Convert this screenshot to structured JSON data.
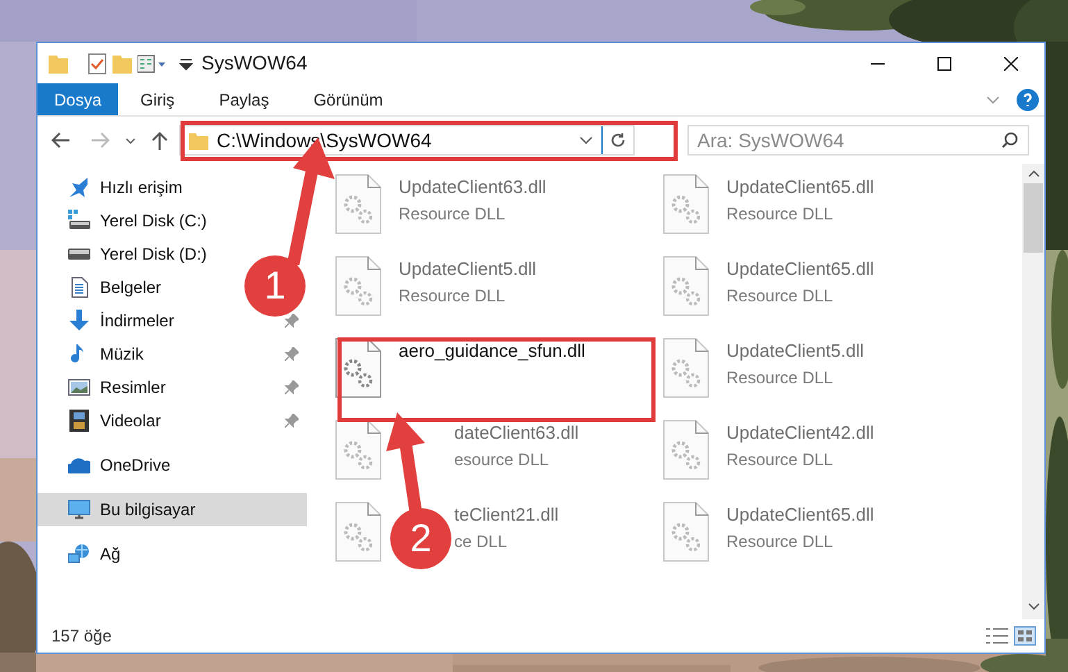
{
  "window": {
    "title": "SysWOW64"
  },
  "ribbon_tabs": [
    {
      "label": "Dosya",
      "selected": true
    },
    {
      "label": "Giriş",
      "selected": false
    },
    {
      "label": "Paylaş",
      "selected": false
    },
    {
      "label": "Görünüm",
      "selected": false
    }
  ],
  "address": {
    "path": "C:\\Windows\\SysWOW64"
  },
  "search": {
    "placeholder": "Ara: SysWOW64"
  },
  "sidebar": {
    "items": [
      {
        "label": "Hızlı erişim",
        "kind": "star",
        "pinned": false,
        "selected": false,
        "group_start": false
      },
      {
        "label": "Yerel Disk (C:)",
        "kind": "sysdrive",
        "pinned": false,
        "selected": false,
        "group_start": false
      },
      {
        "label": "Yerel Disk (D:)",
        "kind": "drive",
        "pinned": false,
        "selected": false,
        "group_start": false
      },
      {
        "label": "Belgeler",
        "kind": "docs",
        "pinned": false,
        "selected": false,
        "group_start": false
      },
      {
        "label": "İndirmeler",
        "kind": "download",
        "pinned": true,
        "selected": false,
        "group_start": false
      },
      {
        "label": "Müzik",
        "kind": "music",
        "pinned": true,
        "selected": false,
        "group_start": false
      },
      {
        "label": "Resimler",
        "kind": "pictures",
        "pinned": true,
        "selected": false,
        "group_start": false
      },
      {
        "label": "Videolar",
        "kind": "video",
        "pinned": true,
        "selected": false,
        "group_start": false
      },
      {
        "label": "OneDrive",
        "kind": "cloud",
        "pinned": false,
        "selected": false,
        "group_start": true
      },
      {
        "label": "Bu bilgisayar",
        "kind": "computer",
        "pinned": false,
        "selected": true,
        "group_start": true
      },
      {
        "label": "Ağ",
        "kind": "network",
        "pinned": false,
        "selected": false,
        "group_start": true
      }
    ]
  },
  "files": [
    {
      "name": "UpdateClient63.dll",
      "type": "Resource DLL",
      "dimmed": true
    },
    {
      "name": "UpdateClient65.dll",
      "type": "Resource DLL",
      "dimmed": true
    },
    {
      "name": "UpdateClient5.dll",
      "type": "Resource DLL",
      "dimmed": true
    },
    {
      "name": "UpdateClient65.dll",
      "type": "Resource DLL",
      "dimmed": true
    },
    {
      "name": "aero_guidance_sfun.dll",
      "dimmed": false
    },
    {
      "name": "UpdateClient5.dll",
      "type": "Resource DLL",
      "dimmed": true
    },
    {
      "name": "dateClient63.dll",
      "type": "esource DLL",
      "dimmed": true,
      "cut_off": true
    },
    {
      "name": "UpdateClient42.dll",
      "type": "Resource DLL",
      "dimmed": true
    },
    {
      "name": "teClient21.dll",
      "type": "ce DLL",
      "dimmed": true,
      "cut_off": true
    },
    {
      "name": "UpdateClient65.dll",
      "type": "Resource DLL",
      "dimmed": true
    }
  ],
  "status_bar": {
    "count": "157 öğe"
  },
  "annotations": [
    {
      "label": "1"
    },
    {
      "label": "2"
    }
  ]
}
